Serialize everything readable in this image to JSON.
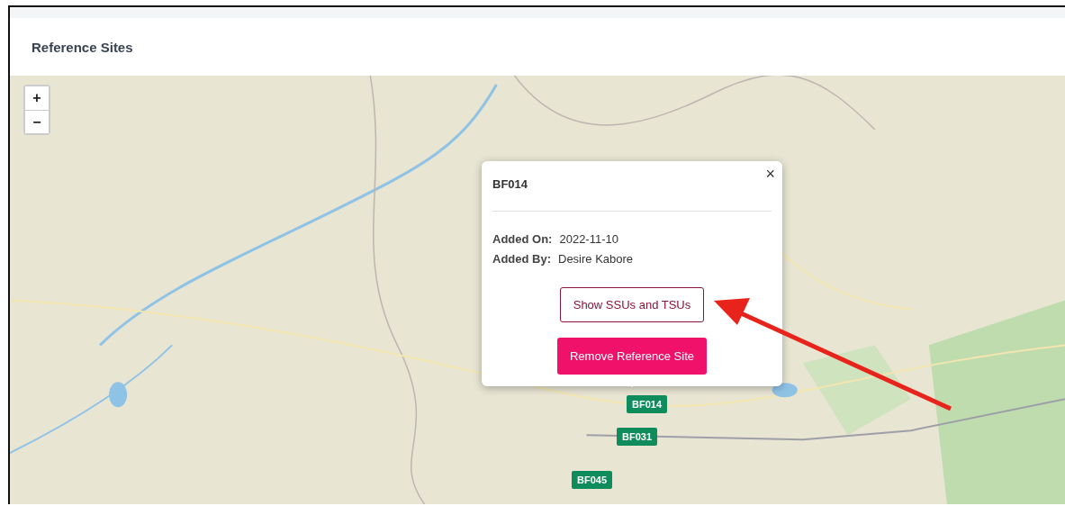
{
  "header": {
    "title": "Reference Sites"
  },
  "map": {
    "kind": "picture",
    "zoom_controls": [
      "+",
      "−"
    ],
    "popup": {
      "title": "BF014",
      "close": "×",
      "fields": [
        {
          "label": "Added On:",
          "value": "2022-11-10"
        },
        {
          "label": "Added By:",
          "value": "Desire Kabore"
        }
      ],
      "buttons": [
        {
          "label": "Show SSUs and TSUs",
          "kind": "outline"
        },
        {
          "label": "Remove Reference Site",
          "kind": "danger"
        }
      ]
    },
    "markers": [
      {
        "label": "BF014"
      },
      {
        "label": "BF031"
      },
      {
        "label": "BF045"
      }
    ]
  }
}
